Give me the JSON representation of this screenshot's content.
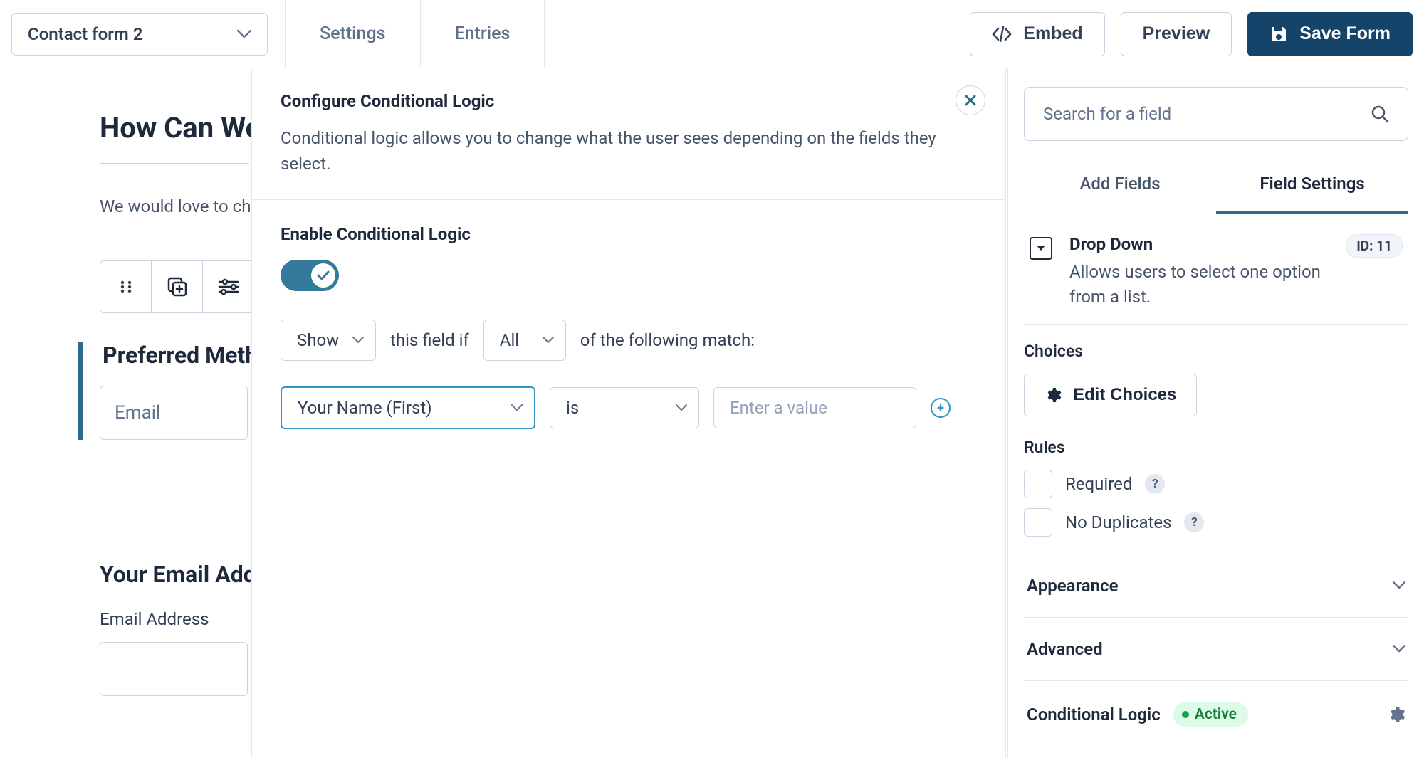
{
  "topbar": {
    "form_name": "Contact form 2",
    "tabs": [
      "Settings",
      "Entries"
    ],
    "embed": "Embed",
    "preview": "Preview",
    "save": "Save Form"
  },
  "canvas": {
    "title": "How Can We",
    "intro": "We would love to chat",
    "section_label": "Preferred Metho",
    "dd_value": "Email",
    "email_section_title": "Your Email Addre",
    "email_sublabel": "Email Address"
  },
  "modal": {
    "title": "Configure Conditional Logic",
    "subtitle": "Conditional logic allows you to change what the user sees depending on the fields they select.",
    "enable_label": "Enable Conditional Logic",
    "show_value": "Show",
    "txt_middle": "this field if",
    "all_value": "All",
    "txt_tail": "of the following match:",
    "cond_field": "Your Name (First)",
    "cond_op": "is",
    "cond_val_placeholder": "Enter a value"
  },
  "sidebar": {
    "search_placeholder": "Search for a field",
    "tabs": {
      "add": "Add Fields",
      "settings": "Field Settings"
    },
    "field": {
      "type": "Drop Down",
      "desc": "Allows users to select one option from a list.",
      "id_label": "ID: 11"
    },
    "choices_label": "Choices",
    "edit_choices": "Edit Choices",
    "rules_label": "Rules",
    "required": "Required",
    "no_duplicates": "No Duplicates",
    "help": "?",
    "appearance": "Appearance",
    "advanced": "Advanced",
    "cond_logic": "Conditional Logic",
    "active": "Active"
  }
}
